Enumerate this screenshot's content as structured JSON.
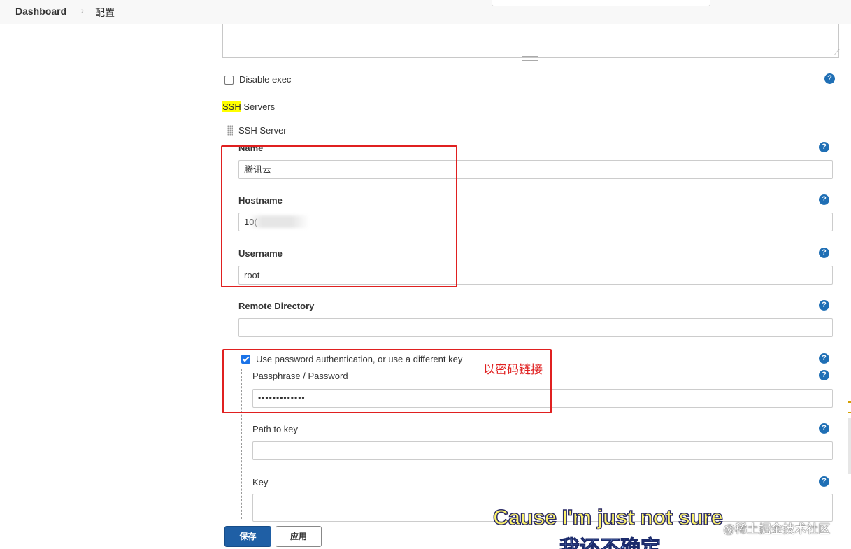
{
  "breadcrumb": {
    "dashboard": "Dashboard",
    "separator": "›",
    "current": "配置"
  },
  "disable_exec": {
    "label": "Disable exec",
    "checked": false
  },
  "ssh_servers": {
    "title_highlight": "SSH",
    "title_rest": " Servers",
    "server_block_title": "SSH Server"
  },
  "fields": {
    "name": {
      "label": "Name",
      "value": "腾讯云"
    },
    "hostname": {
      "label": "Hostname",
      "value": "10("
    },
    "username": {
      "label": "Username",
      "value": "root"
    },
    "remote_directory": {
      "label": "Remote Directory",
      "value": ""
    },
    "use_password": {
      "label": "Use password authentication, or use a different key",
      "checked": true
    },
    "passphrase": {
      "label": "Passphrase / Password",
      "value": "•••••••••••••"
    },
    "path_to_key": {
      "label": "Path to key",
      "value": ""
    },
    "key": {
      "label": "Key",
      "value": ""
    }
  },
  "help_icon_glyph": "?",
  "annotation": {
    "note": "以密码链接",
    "color": "#e02020"
  },
  "buttons": {
    "save": "保存",
    "apply": "应用"
  },
  "overlay": {
    "subtitle_en": "Cause I'm just not sure",
    "subtitle_cn": "我还不确定",
    "watermark": "@稀土掘金技术社区"
  },
  "colors": {
    "primary_button": "#1f5fa5",
    "help_icon": "#1f6fb5",
    "highlight": "#ffff00"
  }
}
